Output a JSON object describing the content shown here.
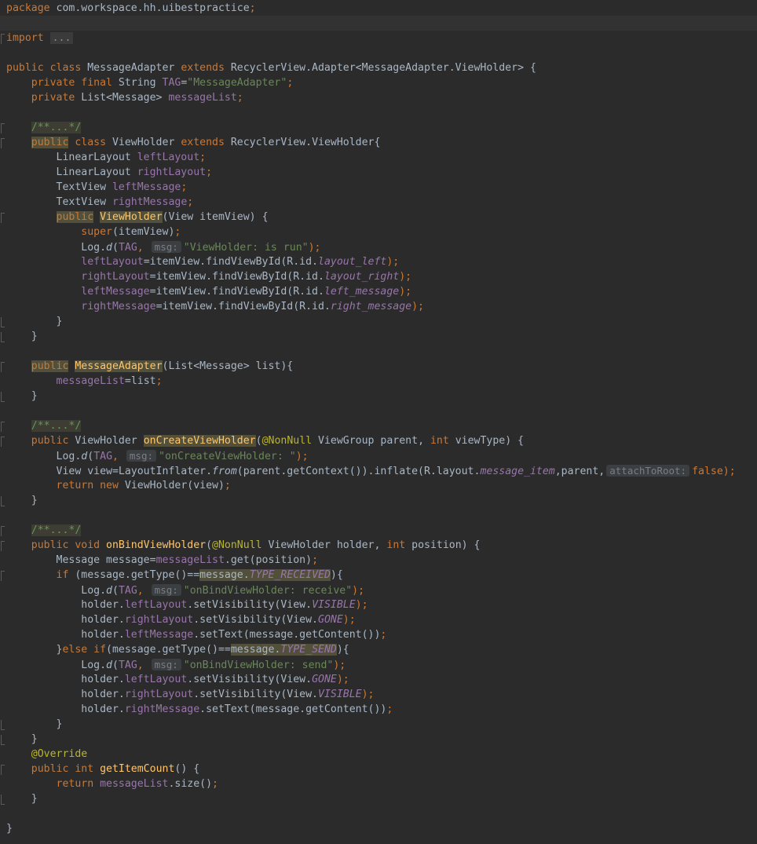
{
  "editor": {
    "lines": [
      {
        "segments": [
          {
            "t": "package ",
            "c": "kw"
          },
          {
            "t": "com.workspace.hh.uibestpractice",
            "c": ""
          },
          {
            "t": ";",
            "c": "kw"
          }
        ]
      },
      {
        "segments": [],
        "caret": true
      },
      {
        "segments": [
          {
            "t": "import ",
            "c": "kw"
          },
          {
            "t": "...",
            "c": "fold"
          }
        ],
        "mark": "start"
      },
      {
        "segments": []
      },
      {
        "segments": [
          {
            "t": "public class ",
            "c": "kw"
          },
          {
            "t": "MessageAdapter ",
            "c": ""
          },
          {
            "t": "extends ",
            "c": "kw"
          },
          {
            "t": "RecyclerView.Adapter<MessageAdapter.ViewHolder> {",
            "c": ""
          }
        ]
      },
      {
        "segments": [
          {
            "t": "    private final ",
            "c": "kw"
          },
          {
            "t": "String ",
            "c": ""
          },
          {
            "t": "TAG",
            "c": "fld"
          },
          {
            "t": "=",
            "c": ""
          },
          {
            "t": "\"MessageAdapter\"",
            "c": "str"
          },
          {
            "t": ";",
            "c": "kw"
          }
        ]
      },
      {
        "segments": [
          {
            "t": "    private ",
            "c": "kw"
          },
          {
            "t": "List<Message> ",
            "c": ""
          },
          {
            "t": "messageList",
            "c": "fld"
          },
          {
            "t": ";",
            "c": "kw"
          }
        ]
      },
      {
        "segments": []
      },
      {
        "segments": [
          {
            "t": "    ",
            "c": ""
          },
          {
            "t": "/**...*/",
            "c": "cmtbox"
          }
        ],
        "mark": "start"
      },
      {
        "segments": [
          {
            "t": "    ",
            "c": ""
          },
          {
            "t": "public",
            "c": "kw hl2"
          },
          {
            "t": " class ",
            "c": "kw"
          },
          {
            "t": "ViewHolder ",
            "c": ""
          },
          {
            "t": "extends ",
            "c": "kw"
          },
          {
            "t": "RecyclerView.ViewHolder{",
            "c": ""
          }
        ],
        "mark": "start"
      },
      {
        "segments": [
          {
            "t": "        LinearLayout ",
            "c": ""
          },
          {
            "t": "leftLayout",
            "c": "fld"
          },
          {
            "t": ";",
            "c": "kw"
          }
        ]
      },
      {
        "segments": [
          {
            "t": "        LinearLayout ",
            "c": ""
          },
          {
            "t": "rightLayout",
            "c": "fld"
          },
          {
            "t": ";",
            "c": "kw"
          }
        ]
      },
      {
        "segments": [
          {
            "t": "        TextView ",
            "c": ""
          },
          {
            "t": "leftMessage",
            "c": "fld"
          },
          {
            "t": ";",
            "c": "kw"
          }
        ]
      },
      {
        "segments": [
          {
            "t": "        TextView ",
            "c": ""
          },
          {
            "t": "rightMessage",
            "c": "fld"
          },
          {
            "t": ";",
            "c": "kw"
          }
        ]
      },
      {
        "segments": [
          {
            "t": "        ",
            "c": ""
          },
          {
            "t": "public",
            "c": "kw hl2"
          },
          {
            "t": " ",
            "c": ""
          },
          {
            "t": "ViewHolder",
            "c": "fn hl2"
          },
          {
            "t": "(View itemView) {",
            "c": ""
          }
        ],
        "mark": "start"
      },
      {
        "segments": [
          {
            "t": "            ",
            "c": ""
          },
          {
            "t": "super",
            "c": "kw"
          },
          {
            "t": "(itemView)",
            "c": ""
          },
          {
            "t": ";",
            "c": "kw"
          }
        ]
      },
      {
        "segments": [
          {
            "t": "            Log.",
            "c": ""
          },
          {
            "t": "d",
            "c": "ital"
          },
          {
            "t": "(",
            "c": ""
          },
          {
            "t": "TAG",
            "c": "fld"
          },
          {
            "t": ", ",
            "c": "kw"
          },
          {
            "t": "msg:",
            "c": "hint"
          },
          {
            "t": "\"ViewHolder: is run\"",
            "c": "str"
          },
          {
            "t": ");",
            "c": "kw"
          }
        ]
      },
      {
        "segments": [
          {
            "t": "            ",
            "c": ""
          },
          {
            "t": "leftLayout",
            "c": "fld"
          },
          {
            "t": "=itemView.findViewById(R.id.",
            "c": ""
          },
          {
            "t": "layout_left",
            "c": "sfld"
          },
          {
            "t": ");",
            "c": "kw"
          }
        ]
      },
      {
        "segments": [
          {
            "t": "            ",
            "c": ""
          },
          {
            "t": "rightLayout",
            "c": "fld"
          },
          {
            "t": "=itemView.findViewById(R.id.",
            "c": ""
          },
          {
            "t": "layout_right",
            "c": "sfld"
          },
          {
            "t": ");",
            "c": "kw"
          }
        ]
      },
      {
        "segments": [
          {
            "t": "            ",
            "c": ""
          },
          {
            "t": "leftMessage",
            "c": "fld"
          },
          {
            "t": "=itemView.findViewById(R.id.",
            "c": ""
          },
          {
            "t": "left_message",
            "c": "sfld"
          },
          {
            "t": ");",
            "c": "kw"
          }
        ]
      },
      {
        "segments": [
          {
            "t": "            ",
            "c": ""
          },
          {
            "t": "rightMessage",
            "c": "fld"
          },
          {
            "t": "=itemView.findViewById(R.id.",
            "c": ""
          },
          {
            "t": "right_message",
            "c": "sfld"
          },
          {
            "t": ");",
            "c": "kw"
          }
        ]
      },
      {
        "segments": [
          {
            "t": "        }",
            "c": ""
          }
        ],
        "mark": "end"
      },
      {
        "segments": [
          {
            "t": "    }",
            "c": ""
          }
        ],
        "mark": "end"
      },
      {
        "segments": []
      },
      {
        "segments": [
          {
            "t": "    ",
            "c": ""
          },
          {
            "t": "public",
            "c": "kw hl2"
          },
          {
            "t": " ",
            "c": ""
          },
          {
            "t": "MessageAdapter",
            "c": "fn hl2"
          },
          {
            "t": "(List<Message> list){",
            "c": ""
          }
        ],
        "mark": "start"
      },
      {
        "segments": [
          {
            "t": "        ",
            "c": ""
          },
          {
            "t": "messageList",
            "c": "fld"
          },
          {
            "t": "=list",
            "c": ""
          },
          {
            "t": ";",
            "c": "kw"
          }
        ]
      },
      {
        "segments": [
          {
            "t": "    }",
            "c": ""
          }
        ],
        "mark": "end"
      },
      {
        "segments": []
      },
      {
        "segments": [
          {
            "t": "    ",
            "c": ""
          },
          {
            "t": "/**...*/",
            "c": "cmtbox"
          }
        ],
        "mark": "start"
      },
      {
        "segments": [
          {
            "t": "    ",
            "c": ""
          },
          {
            "t": "public ",
            "c": "kw"
          },
          {
            "t": "ViewHolder ",
            "c": ""
          },
          {
            "t": "onCreateViewHolder",
            "c": "fn hl2"
          },
          {
            "t": "(",
            "c": ""
          },
          {
            "t": "@NonNull",
            "c": "ann"
          },
          {
            "t": " ViewGroup parent, ",
            "c": ""
          },
          {
            "t": "int ",
            "c": "kw"
          },
          {
            "t": "viewType) {",
            "c": ""
          }
        ],
        "mark": "start"
      },
      {
        "segments": [
          {
            "t": "        Log.",
            "c": ""
          },
          {
            "t": "d",
            "c": "ital"
          },
          {
            "t": "(",
            "c": ""
          },
          {
            "t": "TAG",
            "c": "fld"
          },
          {
            "t": ", ",
            "c": "kw"
          },
          {
            "t": "msg:",
            "c": "hint"
          },
          {
            "t": "\"onCreateViewHolder: \"",
            "c": "str"
          },
          {
            "t": ");",
            "c": "kw"
          }
        ]
      },
      {
        "segments": [
          {
            "t": "        View view=LayoutInflater.",
            "c": ""
          },
          {
            "t": "from",
            "c": "ital"
          },
          {
            "t": "(parent.getContext()).inflate(R.layout.",
            "c": ""
          },
          {
            "t": "message_item",
            "c": "sfld"
          },
          {
            "t": ",parent,",
            "c": ""
          },
          {
            "t": "attachToRoot:",
            "c": "hint"
          },
          {
            "t": "false",
            "c": "kw"
          },
          {
            "t": ");",
            "c": "kw"
          }
        ]
      },
      {
        "segments": [
          {
            "t": "        ",
            "c": ""
          },
          {
            "t": "return new ",
            "c": "kw"
          },
          {
            "t": "ViewHolder(view)",
            "c": ""
          },
          {
            "t": ";",
            "c": "kw"
          }
        ]
      },
      {
        "segments": [
          {
            "t": "    }",
            "c": ""
          }
        ],
        "mark": "end"
      },
      {
        "segments": []
      },
      {
        "segments": [
          {
            "t": "    ",
            "c": ""
          },
          {
            "t": "/**...*/",
            "c": "cmtbox"
          }
        ],
        "mark": "start"
      },
      {
        "segments": [
          {
            "t": "    ",
            "c": ""
          },
          {
            "t": "public void ",
            "c": "kw"
          },
          {
            "t": "onBindViewHolder",
            "c": "fn"
          },
          {
            "t": "(",
            "c": ""
          },
          {
            "t": "@NonNull",
            "c": "ann"
          },
          {
            "t": " ViewHolder holder, ",
            "c": ""
          },
          {
            "t": "int ",
            "c": "kw"
          },
          {
            "t": "position) {",
            "c": ""
          }
        ],
        "mark": "start"
      },
      {
        "segments": [
          {
            "t": "        Message message=",
            "c": ""
          },
          {
            "t": "messageList",
            "c": "fld"
          },
          {
            "t": ".get(position)",
            "c": ""
          },
          {
            "t": ";",
            "c": "kw"
          }
        ]
      },
      {
        "segments": [
          {
            "t": "        ",
            "c": ""
          },
          {
            "t": "if ",
            "c": "kw"
          },
          {
            "t": "(message.getType()==",
            "c": ""
          },
          {
            "t": "message.",
            "c": "hl2"
          },
          {
            "t": "TYPE_RECEIVED",
            "c": "sfld hl2"
          },
          {
            "t": "){",
            "c": ""
          }
        ],
        "mark": "start"
      },
      {
        "segments": [
          {
            "t": "            Log.",
            "c": ""
          },
          {
            "t": "d",
            "c": "ital"
          },
          {
            "t": "(",
            "c": ""
          },
          {
            "t": "TAG",
            "c": "fld"
          },
          {
            "t": ", ",
            "c": "kw"
          },
          {
            "t": "msg:",
            "c": "hint"
          },
          {
            "t": "\"onBindViewHolder: receive\"",
            "c": "str"
          },
          {
            "t": ");",
            "c": "kw"
          }
        ]
      },
      {
        "segments": [
          {
            "t": "            holder.",
            "c": ""
          },
          {
            "t": "leftLayout",
            "c": "fld"
          },
          {
            "t": ".setVisibility(View.",
            "c": ""
          },
          {
            "t": "VISIBLE",
            "c": "sfld"
          },
          {
            "t": ");",
            "c": "kw"
          }
        ]
      },
      {
        "segments": [
          {
            "t": "            holder.",
            "c": ""
          },
          {
            "t": "rightLayout",
            "c": "fld"
          },
          {
            "t": ".setVisibility(View.",
            "c": ""
          },
          {
            "t": "GONE",
            "c": "sfld"
          },
          {
            "t": ");",
            "c": "kw"
          }
        ]
      },
      {
        "segments": [
          {
            "t": "            holder.",
            "c": ""
          },
          {
            "t": "leftMessage",
            "c": "fld"
          },
          {
            "t": ".setText(message.getContent())",
            "c": ""
          },
          {
            "t": ";",
            "c": "kw"
          }
        ]
      },
      {
        "segments": [
          {
            "t": "        }",
            "c": ""
          },
          {
            "t": "else if",
            "c": "kw"
          },
          {
            "t": "(message.getType()==",
            "c": ""
          },
          {
            "t": "message.",
            "c": "hl2"
          },
          {
            "t": "TYPE_SEND",
            "c": "sfld hl2"
          },
          {
            "t": "){",
            "c": ""
          }
        ]
      },
      {
        "segments": [
          {
            "t": "            Log.",
            "c": ""
          },
          {
            "t": "d",
            "c": "ital"
          },
          {
            "t": "(",
            "c": ""
          },
          {
            "t": "TAG",
            "c": "fld"
          },
          {
            "t": ", ",
            "c": "kw"
          },
          {
            "t": "msg:",
            "c": "hint"
          },
          {
            "t": "\"onBindViewHolder: send\"",
            "c": "str"
          },
          {
            "t": ");",
            "c": "kw"
          }
        ]
      },
      {
        "segments": [
          {
            "t": "            holder.",
            "c": ""
          },
          {
            "t": "leftLayout",
            "c": "fld"
          },
          {
            "t": ".setVisibility(View.",
            "c": ""
          },
          {
            "t": "GONE",
            "c": "sfld"
          },
          {
            "t": ");",
            "c": "kw"
          }
        ]
      },
      {
        "segments": [
          {
            "t": "            holder.",
            "c": ""
          },
          {
            "t": "rightLayout",
            "c": "fld"
          },
          {
            "t": ".setVisibility(View.",
            "c": ""
          },
          {
            "t": "VISIBLE",
            "c": "sfld"
          },
          {
            "t": ");",
            "c": "kw"
          }
        ]
      },
      {
        "segments": [
          {
            "t": "            holder.",
            "c": ""
          },
          {
            "t": "rightMessage",
            "c": "fld"
          },
          {
            "t": ".setText(message.getContent())",
            "c": ""
          },
          {
            "t": ";",
            "c": "kw"
          }
        ]
      },
      {
        "segments": [
          {
            "t": "        }",
            "c": ""
          }
        ],
        "mark": "end"
      },
      {
        "segments": [
          {
            "t": "    }",
            "c": ""
          }
        ],
        "mark": "end"
      },
      {
        "segments": [
          {
            "t": "    ",
            "c": ""
          },
          {
            "t": "@Override",
            "c": "ann"
          }
        ]
      },
      {
        "segments": [
          {
            "t": "    ",
            "c": ""
          },
          {
            "t": "public int ",
            "c": "kw"
          },
          {
            "t": "getItemCount",
            "c": "fn"
          },
          {
            "t": "() {",
            "c": ""
          }
        ],
        "mark": "start"
      },
      {
        "segments": [
          {
            "t": "        ",
            "c": ""
          },
          {
            "t": "return ",
            "c": "kw"
          },
          {
            "t": "messageList",
            "c": "fld"
          },
          {
            "t": ".size()",
            "c": ""
          },
          {
            "t": ";",
            "c": "kw"
          }
        ]
      },
      {
        "segments": [
          {
            "t": "    }",
            "c": ""
          }
        ],
        "mark": "end"
      },
      {
        "segments": []
      },
      {
        "segments": [
          {
            "t": "}",
            "c": ""
          }
        ]
      }
    ]
  }
}
